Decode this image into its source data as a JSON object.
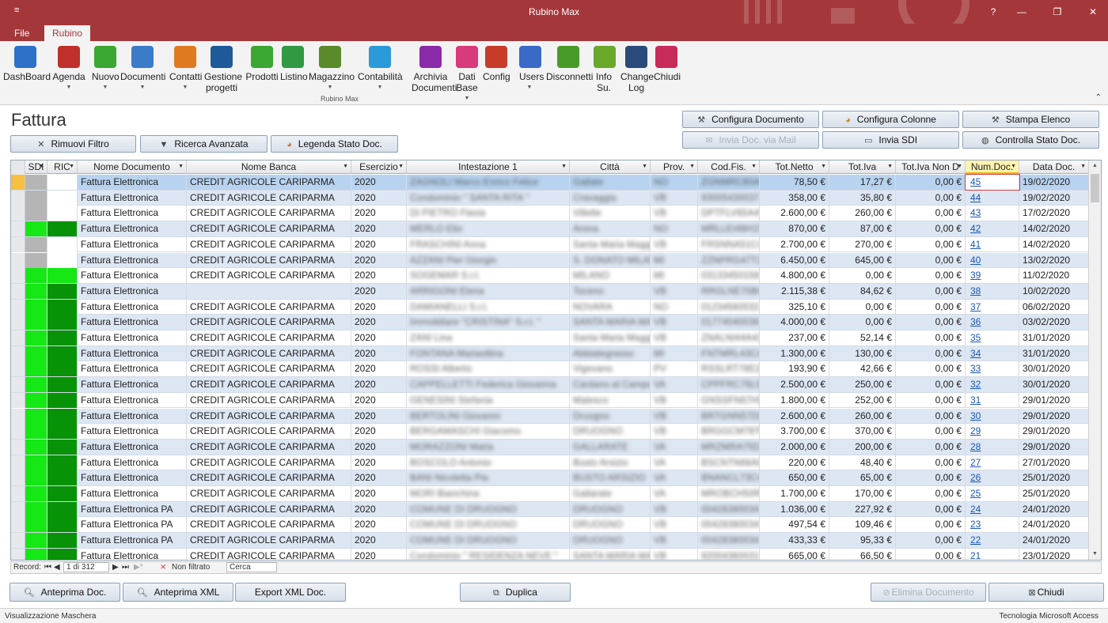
{
  "window": {
    "title": "Rubino Max",
    "qa_icon": "≡",
    "help": "?",
    "minimize": "—",
    "maximize": "❐",
    "close": "✕"
  },
  "tabs": [
    {
      "label": "File"
    },
    {
      "label": "Rubino"
    }
  ],
  "ribbon": {
    "group_label": "Rubino Max",
    "items": [
      {
        "label": "DashBoard",
        "icon": "laptop-icon",
        "color": "#2b72c8",
        "dropdown": false
      },
      {
        "label": "Agenda",
        "icon": "agenda-icon",
        "color": "#c0302a",
        "dropdown": true
      },
      {
        "label": "Nuovo",
        "icon": "new-icon",
        "color": "#3aa832",
        "dropdown": true
      },
      {
        "label": "Documenti",
        "icon": "documents-icon",
        "color": "#3a7cc8",
        "dropdown": true
      },
      {
        "label": "Contatti",
        "icon": "contacts-icon",
        "color": "#e07a20",
        "dropdown": true
      },
      {
        "label": "Gestione\nprogetti",
        "icon": "projects-icon",
        "color": "#1e5a9a",
        "dropdown": false
      },
      {
        "label": "Prodotti",
        "icon": "products-icon",
        "color": "#3aa832",
        "dropdown": false
      },
      {
        "label": "Listino",
        "icon": "price-list-icon",
        "color": "#2f9a42",
        "dropdown": false
      },
      {
        "label": "Magazzino",
        "icon": "warehouse-icon",
        "color": "#5a8a2a",
        "dropdown": true
      },
      {
        "label": "Contabilità",
        "icon": "accounting-icon",
        "color": "#2a9ad8",
        "dropdown": true
      },
      {
        "label": "Archivia\nDocumenti",
        "icon": "archive-icon",
        "color": "#8a2aa8",
        "dropdown": false
      },
      {
        "label": "Dati\nBase",
        "icon": "database-icon",
        "color": "#d83a7a",
        "dropdown": true
      },
      {
        "label": "Config",
        "icon": "config-icon",
        "color": "#c83a2a",
        "dropdown": false
      },
      {
        "label": "Users",
        "icon": "users-icon",
        "color": "#3a6ac8",
        "dropdown": true
      },
      {
        "label": "Disconnetti",
        "icon": "disconnect-icon",
        "color": "#4a9a2a",
        "dropdown": false
      },
      {
        "label": "Info\nSu.",
        "icon": "info-icon",
        "color": "#6aa82a",
        "dropdown": false
      },
      {
        "label": "Change\nLog",
        "icon": "changelog-icon",
        "color": "#2a4a7a",
        "dropdown": false
      },
      {
        "label": "Chiudi",
        "icon": "close-app-icon",
        "color": "#c82a5a",
        "dropdown": false
      }
    ],
    "collapse": "⌃"
  },
  "page": {
    "title": "Fattura"
  },
  "actions": {
    "rimuovi_filtro": "Rimuovi Filtro",
    "ricerca_avanzata": "Ricerca Avanzata",
    "legenda": "Legenda Stato Doc.",
    "configura_documento": "Configura Documento",
    "configura_colonne": "Configura Colonne",
    "stampa_elenco": "Stampa Elenco",
    "invia_mail": "Invia Doc. via Mail",
    "invia_sdi": "Invia SDI",
    "controlla_stato": "Controlla Stato Doc."
  },
  "grid": {
    "columns": [
      "SDI",
      "RIC",
      "Nome Documento",
      "Nome Banca",
      "Esercizio",
      "Intestazione 1",
      "Città",
      "Prov.",
      "Cod.Fis.",
      "Tot.Netto",
      "Tot.Iva",
      "Tot.Iva Non D",
      "Num.Doc.",
      "Data Doc."
    ],
    "rows": [
      {
        "sdi": "gray",
        "ric": "white",
        "doc": "Fattura Elettronica",
        "banca": "CREDIT AGRICOLE CARIPARMA",
        "es": "2020",
        "int": "ZAGNOLI Marco Enrico Felice",
        "citta": "Gallate",
        "prov": "NO",
        "cf": "ZGNMRC80A01D969X",
        "netto": "78,50 €",
        "iva": "17,27 €",
        "ivand": "0,00 €",
        "num": "45",
        "data": "19/02/2020"
      },
      {
        "sdi": "gray",
        "ric": "white",
        "doc": "Fattura Elettronica",
        "banca": "CREDIT AGRICOLE CARIPARMA",
        "es": "2020",
        "int": "Condominio \" SANTA RITA \"",
        "citta": "Cravaggia",
        "prov": "VB",
        "cf": "93005430037",
        "netto": "358,00 €",
        "iva": "35,80 €",
        "ivand": "0,00 €",
        "num": "44",
        "data": "19/02/2020"
      },
      {
        "sdi": "gray",
        "ric": "white",
        "doc": "Fattura Elettronica",
        "banca": "CREDIT AGRICOLE CARIPARMA",
        "es": "2020",
        "int": "DI PIETRO Flavia",
        "citta": "Villette",
        "prov": "VB",
        "cf": "DPTFLV65A41H037",
        "netto": "2.600,00 €",
        "iva": "260,00 €",
        "ivand": "0,00 €",
        "num": "43",
        "data": "17/02/2020"
      },
      {
        "sdi": "green",
        "ric": "dark",
        "doc": "Fattura Elettronica",
        "banca": "CREDIT AGRICOLE CARIPARMA",
        "es": "2020",
        "int": "MERLO Elio",
        "citta": "Arona",
        "prov": "NO",
        "cf": "MRLLEI48H15A429",
        "netto": "870,00 €",
        "iva": "87,00 €",
        "ivand": "0,00 €",
        "num": "42",
        "data": "14/02/2020"
      },
      {
        "sdi": "gray",
        "ric": "white",
        "doc": "Fattura Elettronica",
        "banca": "CREDIT AGRICOLE CARIPARMA",
        "es": "2020",
        "int": "FRASCHINI Anna",
        "citta": "Santa Maria Maggiore",
        "prov": "VB",
        "cf": "FRSNNA51C44I249",
        "netto": "2.700,00 €",
        "iva": "270,00 €",
        "ivand": "0,00 €",
        "num": "41",
        "data": "14/02/2020"
      },
      {
        "sdi": "gray",
        "ric": "white",
        "doc": "Fattura Elettronica",
        "banca": "CREDIT AGRICOLE CARIPARMA",
        "es": "2020",
        "int": "AZZANI Pier Giorgio",
        "citta": "S. DONATO MILANESE",
        "prov": "MI",
        "cf": "ZZNPRG47T22C618",
        "netto": "6.450,00 €",
        "iva": "645,00 €",
        "ivand": "0,00 €",
        "num": "40",
        "data": "13/02/2020"
      },
      {
        "sdi": "green",
        "ric": "green",
        "doc": "Fattura Elettronica",
        "banca": "CREDIT AGRICOLE CARIPARMA",
        "es": "2020",
        "int": "SOGEMAR S.r.l.",
        "citta": "MILANO",
        "prov": "MI",
        "cf": "03133450158",
        "netto": "4.800,00 €",
        "iva": "0,00 €",
        "ivand": "0,00 €",
        "num": "39",
        "data": "11/02/2020"
      },
      {
        "sdi": "green",
        "ric": "dark",
        "doc": "Fattura Elettronica",
        "banca": "",
        "es": "2020",
        "int": "ARRIGONI Elena",
        "citta": "Toceno",
        "prov": "VB",
        "cf": "RRGLNE70B47I576",
        "netto": "2.115,38 €",
        "iva": "84,62 €",
        "ivand": "0,00 €",
        "num": "38",
        "data": "10/02/2020"
      },
      {
        "sdi": "green",
        "ric": "dark",
        "doc": "Fattura Elettronica",
        "banca": "CREDIT AGRICOLE CARIPARMA",
        "es": "2020",
        "int": "DAMIANELLI S.r.l.",
        "citta": "NOVARA",
        "prov": "NO",
        "cf": "01234560032",
        "netto": "325,10 €",
        "iva": "0,00 €",
        "ivand": "0,00 €",
        "num": "37",
        "data": "06/02/2020"
      },
      {
        "sdi": "green",
        "ric": "dark",
        "doc": "Fattura Elettronica",
        "banca": "CREDIT AGRICOLE CARIPARMA",
        "es": "2020",
        "int": "Immobiliare \"CRISTINA\" S.r.l. \"",
        "citta": "SANTA MARIA MAGGIORE",
        "prov": "VB",
        "cf": "01774040036",
        "netto": "4.000,00 €",
        "iva": "0,00 €",
        "ivand": "0,00 €",
        "num": "36",
        "data": "03/02/2020"
      },
      {
        "sdi": "green",
        "ric": "dark",
        "doc": "Fattura Elettronica",
        "banca": "CREDIT AGRICOLE CARIPARMA",
        "es": "2020",
        "int": "ZANI Lina",
        "citta": "Santa Maria Maggiore",
        "prov": "VB",
        "cf": "ZNALNI44A41I249",
        "netto": "237,00 €",
        "iva": "52,14 €",
        "ivand": "0,00 €",
        "num": "35",
        "data": "31/01/2020"
      },
      {
        "sdi": "green",
        "ric": "dark",
        "doc": "Fattura Elettronica",
        "banca": "CREDIT AGRICOLE CARIPARMA",
        "es": "2020",
        "int": "FONTANA Mariaoltina",
        "citta": "Abbiategrasso",
        "prov": "MI",
        "cf": "FNTMRL43C48A010",
        "netto": "1.300,00 €",
        "iva": "130,00 €",
        "ivand": "0,00 €",
        "num": "34",
        "data": "31/01/2020"
      },
      {
        "sdi": "green",
        "ric": "dark",
        "doc": "Fattura Elettronica",
        "banca": "CREDIT AGRICOLE CARIPARMA",
        "es": "2020",
        "int": "ROSSI Alberto",
        "citta": "Vigevano",
        "prov": "PV",
        "cf": "RSSLRT78E20L872",
        "netto": "193,90 €",
        "iva": "42,66 €",
        "ivand": "0,00 €",
        "num": "33",
        "data": "30/01/2020"
      },
      {
        "sdi": "green",
        "ric": "dark",
        "doc": "Fattura Elettronica",
        "banca": "CREDIT AGRICOLE CARIPARMA",
        "es": "2020",
        "int": "CAPPELLETTI Federica Giovanna",
        "citta": "Cardano al Campo",
        "prov": "VA",
        "cf": "CPPFRC76L52B300",
        "netto": "2.500,00 €",
        "iva": "250,00 €",
        "ivand": "0,00 €",
        "num": "32",
        "data": "30/01/2020"
      },
      {
        "sdi": "green",
        "ric": "dark",
        "doc": "Fattura Elettronica",
        "banca": "CREDIT AGRICOLE CARIPARMA",
        "es": "2020",
        "int": "GENESINI Stefania",
        "citta": "Malesco",
        "prov": "VB",
        "cf": "GNSSFN67H51E853",
        "netto": "1.800,00 €",
        "iva": "252,00 €",
        "ivand": "0,00 €",
        "num": "31",
        "data": "29/01/2020"
      },
      {
        "sdi": "green",
        "ric": "dark",
        "doc": "Fattura Elettronica",
        "banca": "CREDIT AGRICOLE CARIPARMA",
        "es": "2020",
        "int": "BERTOLINI Giovanni",
        "citta": "Druogno",
        "prov": "VB",
        "cf": "BRTGNN57D07D374",
        "netto": "2.600,00 €",
        "iva": "260,00 €",
        "ivand": "0,00 €",
        "num": "30",
        "data": "29/01/2020"
      },
      {
        "sdi": "green",
        "ric": "dark",
        "doc": "Fattura Elettronica",
        "banca": "CREDIT AGRICOLE CARIPARMA",
        "es": "2020",
        "int": "BERGAMASCHI Giacomo",
        "citta": "DRUOGNO",
        "prov": "VB",
        "cf": "BRGGCM78T03D374",
        "netto": "3.700,00 €",
        "iva": "370,00 €",
        "ivand": "0,00 €",
        "num": "29",
        "data": "29/01/2020"
      },
      {
        "sdi": "green",
        "ric": "dark",
        "doc": "Fattura Elettronica",
        "banca": "CREDIT AGRICOLE CARIPARMA",
        "es": "2020",
        "int": "MORAZZONI Maria",
        "citta": "GALLARATE",
        "prov": "VA",
        "cf": "MRZMRA75D41D869",
        "netto": "2.000,00 €",
        "iva": "200,00 €",
        "ivand": "0,00 €",
        "num": "28",
        "data": "29/01/2020"
      },
      {
        "sdi": "green",
        "ric": "dark",
        "doc": "Fattura Elettronica",
        "banca": "CREDIT AGRICOLE CARIPARMA",
        "es": "2020",
        "int": "BOSCOLO Antonio",
        "citta": "Busto Arsizio",
        "prov": "VA",
        "cf": "BSCNTN66A01B300",
        "netto": "220,00 €",
        "iva": "48,40 €",
        "ivand": "0,00 €",
        "num": "27",
        "data": "27/01/2020"
      },
      {
        "sdi": "green",
        "ric": "dark",
        "doc": "Fattura Elettronica",
        "banca": "CREDIT AGRICOLE CARIPARMA",
        "es": "2020",
        "int": "BANI Nicoletta Pia",
        "citta": "BUSTO ARSIZIO",
        "prov": "VA",
        "cf": "BNANCL73C45B300",
        "netto": "650,00 €",
        "iva": "65,00 €",
        "ivand": "0,00 €",
        "num": "26",
        "data": "25/01/2020"
      },
      {
        "sdi": "green",
        "ric": "dark",
        "doc": "Fattura Elettronica",
        "banca": "CREDIT AGRICOLE CARIPARMA",
        "es": "2020",
        "int": "MORI Bianchina",
        "citta": "Gallarate",
        "prov": "VA",
        "cf": "MROBCH50R61D869",
        "netto": "1.700,00 €",
        "iva": "170,00 €",
        "ivand": "0,00 €",
        "num": "25",
        "data": "25/01/2020"
      },
      {
        "sdi": "green",
        "ric": "dark",
        "doc": "Fattura Elettronica PA",
        "banca": "CREDIT AGRICOLE CARIPARMA",
        "es": "2020",
        "int": "COMUNE DI DRUOGNO",
        "citta": "DRUOGNO",
        "prov": "VB",
        "cf": "00428380034",
        "netto": "1.036,00 €",
        "iva": "227,92 €",
        "ivand": "0,00 €",
        "num": "24",
        "data": "24/01/2020"
      },
      {
        "sdi": "green",
        "ric": "dark",
        "doc": "Fattura Elettronica PA",
        "banca": "CREDIT AGRICOLE CARIPARMA",
        "es": "2020",
        "int": "COMUNE DI DRUOGNO",
        "citta": "DRUOGNO",
        "prov": "VB",
        "cf": "00428380034",
        "netto": "497,54 €",
        "iva": "109,46 €",
        "ivand": "0,00 €",
        "num": "23",
        "data": "24/01/2020"
      },
      {
        "sdi": "green",
        "ric": "dark",
        "doc": "Fattura Elettronica PA",
        "banca": "CREDIT AGRICOLE CARIPARMA",
        "es": "2020",
        "int": "COMUNE DI DRUOGNO",
        "citta": "DRUOGNO",
        "prov": "VB",
        "cf": "00428380034",
        "netto": "433,33 €",
        "iva": "95,33 €",
        "ivand": "0,00 €",
        "num": "22",
        "data": "24/01/2020"
      },
      {
        "sdi": "green",
        "ric": "dark",
        "doc": "Fattura Elettronica",
        "banca": "CREDIT AGRICOLE CARIPARMA",
        "es": "2020",
        "int": "Condominio \" RESIDENZA NEVE \"",
        "citta": "SANTA MARIA MAGGIORE",
        "prov": "VB",
        "cf": "92004360031",
        "netto": "665,00 €",
        "iva": "66,50 €",
        "ivand": "0,00 €",
        "num": "21",
        "data": "23/01/2020"
      }
    ]
  },
  "nav": {
    "record_label": "Record:",
    "first": "⏮",
    "prev": "◀",
    "position": "1 di 312",
    "next": "▶",
    "last": "⏭",
    "new": "▶*",
    "filter": "Non filtrato",
    "search_placeholder": "Cerca"
  },
  "bottom": {
    "anteprima_doc": "Anteprima Doc.",
    "anteprima_xml": "Anteprima XML",
    "export_xml": "Export XML Doc.",
    "duplica": "Duplica",
    "elimina": "Elimina Documento",
    "chiudi": "Chiudi"
  },
  "status": {
    "left": "Visualizzazione Maschera",
    "right": "Tecnologia Microsoft Access"
  }
}
